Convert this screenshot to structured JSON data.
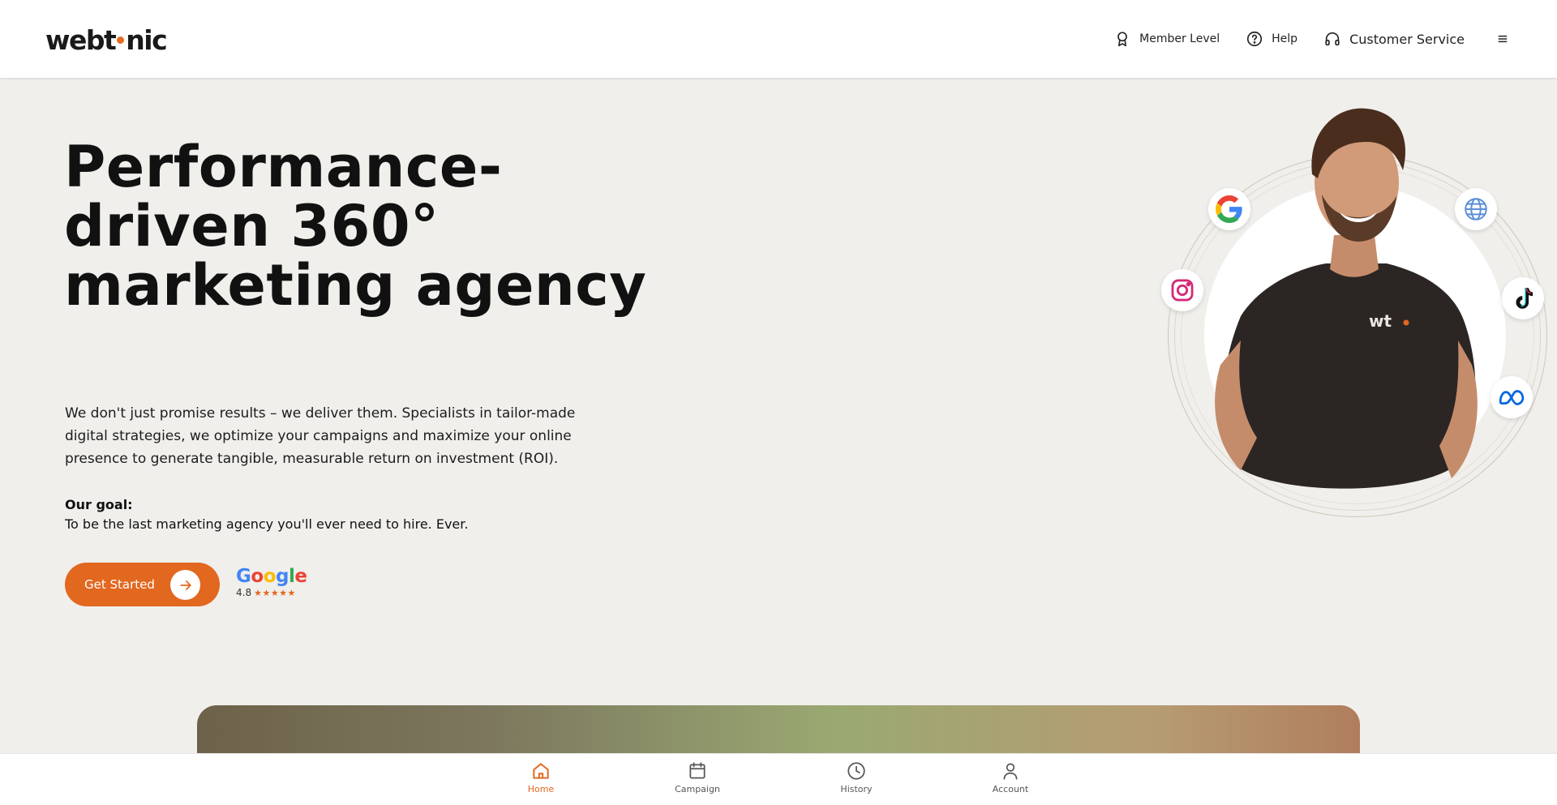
{
  "brand": {
    "logo_prefix": "webt",
    "logo_suffix": "nic",
    "accent": "#e2671f"
  },
  "header": {
    "nav": [
      {
        "label": "Member Level",
        "icon": "award-icon"
      },
      {
        "label": "Help",
        "icon": "help-circle-icon"
      },
      {
        "label": "Customer Service",
        "icon": "headphones-icon"
      }
    ],
    "menu_icon": "hamburger-menu-icon"
  },
  "hero": {
    "title": "Performance-driven 360° marketing agency",
    "description": "We don't just promise results – we deliver them. Specialists in tailor-made digital strategies, we optimize your campaigns and maximize your online presence to generate tangible, measurable return on investment (ROI).",
    "goal_label": "Our goal:",
    "goal_text": "To be the last marketing agency you'll ever need to hire. Ever.",
    "cta_label": "Get Started"
  },
  "rating": {
    "provider": "Google",
    "score": "4.8",
    "stars": 5
  },
  "portrait": {
    "shirt_logo": "wt",
    "social_icons": [
      "google-icon",
      "globe-icon",
      "instagram-icon",
      "tiktok-icon",
      "meta-icon"
    ]
  },
  "bottom_nav": [
    {
      "label": "Home",
      "icon": "home-icon",
      "active": true
    },
    {
      "label": "Campaign",
      "icon": "calendar-icon",
      "active": false
    },
    {
      "label": "History",
      "icon": "clock-icon",
      "active": false
    },
    {
      "label": "Account",
      "icon": "user-icon",
      "active": false
    }
  ]
}
